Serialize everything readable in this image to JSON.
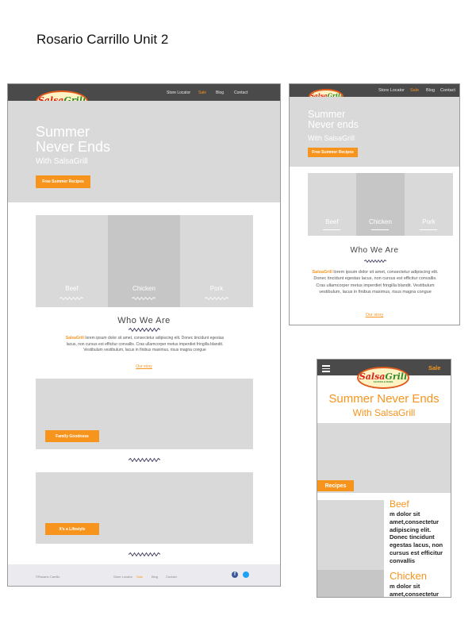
{
  "page_title": "Rosario Carrillo Unit 2",
  "colors": {
    "accent": "#f7941d",
    "nav": "#4a4a4a",
    "placeholder": "#d9d9d9",
    "squiggle": "#3e3a5e"
  },
  "logo": {
    "main_a": "Salsa",
    "main_b": "Grill",
    "sub": "SAUCES & RUBS"
  },
  "desktop": {
    "nav": [
      "Store Locator",
      "Sale",
      "Blog",
      "Contact"
    ],
    "hero_title_1": "Summer",
    "hero_title_2": "Never Ends",
    "hero_sub": "With SalsaGrill",
    "hero_button": "Free Summer Recipes",
    "panels": [
      "Beef",
      "Chicken",
      "Pork"
    ],
    "who_title": "Who We Are",
    "who_brand": "SalsaGrill",
    "who_text": " lorem ipsum dolor sit amet, consectetur adipiscing elit. Donec tincidunt egestas lacus, non cursus est efficitur convallis. Cras ullamcorper metus imperdiet fringilla blandit. Vestibulum vestibulum, lacus in finibus maximus, risus magna congue",
    "who_link": "Our story",
    "block1_button": "Family Goodness",
    "block2_button": "It's a Lifestyle",
    "footer_name": "©Rosario Carrillo",
    "footer_nav": [
      "Store Locator",
      "Sale",
      "Blog",
      "Contact"
    ]
  },
  "tablet": {
    "nav": [
      "Store Locator",
      "Sale",
      "Blog",
      "Contact"
    ],
    "hero_title_1": "Summer",
    "hero_title_2": "Never ends",
    "hero_sub": "With SalsaGrill",
    "hero_button": "Free Summer Recipes",
    "panels": [
      "Beef",
      "Chicken",
      "Pork"
    ],
    "who_title": "Who We Are",
    "who_brand": "SalsaGrill",
    "who_text": " lorem ipsum dolor sit amet, consectetur adipiscing elit. Donec tincidunt egestas lacus, non cursus est efficitur convallis. Cras ullamcorper metus imperdiet fringilla blandit. Vestibulum vestibulum, lacus in finibus maximus, risus magna congue",
    "who_link": "Our story"
  },
  "mobile": {
    "nav_sale": "Sale",
    "hero_title": "Summer Never Ends",
    "hero_sub": "With SalsaGrill",
    "recipes_label": "Recipes",
    "card1_title": "Beef",
    "card1_text": "m dolor sit amet,consectetur adipiscing elit. Donec tincidunt egestas lacus, non cursus est efficitur convallis",
    "card2_title": "Chicken",
    "card2_text": "m dolor sit amet,consectetur adipiscing elit."
  }
}
